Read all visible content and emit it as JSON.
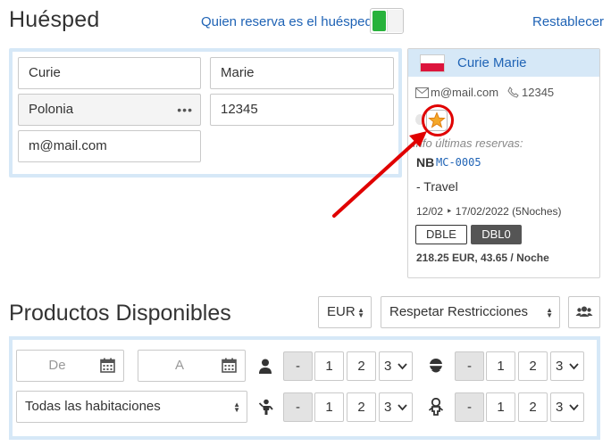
{
  "header": {
    "title": "Huésped",
    "toggle_label": "Quien reserva es el huésped",
    "reset_link": "Restablecer"
  },
  "guest_form": {
    "last_name": "Curie",
    "first_name": "Marie",
    "country": "Polonia",
    "country_menu_glyph": "•••",
    "postal_code": "12345",
    "email": "m@mail.com"
  },
  "guest_card": {
    "name": "Curie Marie",
    "flag": "poland-flag",
    "email": "m@mail.com",
    "phone": "12345",
    "info_label": "Info últimas reservas:",
    "nb_label": "NB",
    "reservation_code": "MC-0005",
    "channel": "- Travel",
    "dates": "12/02 ‣ 17/02/2022 (5Noches)",
    "room_type_badge": "DBLE",
    "rate_badge": "DBL0",
    "price": "218.25 EUR, 43.65 / Noche"
  },
  "products": {
    "title": "Productos Disponibles",
    "currency": "EUR",
    "restrictions": "Respetar Restricciones",
    "date_from_placeholder": "De",
    "date_to_placeholder": "A",
    "rooms_select": "Todas las habitaciones",
    "steppers": {
      "minus": "-",
      "one": "1",
      "two": "2",
      "three": "3"
    }
  },
  "colors": {
    "accent_link": "#1f63b5",
    "toggle_on": "#27b23b",
    "panel_bg": "#d6e8f7",
    "annotation_red": "#e00000"
  }
}
